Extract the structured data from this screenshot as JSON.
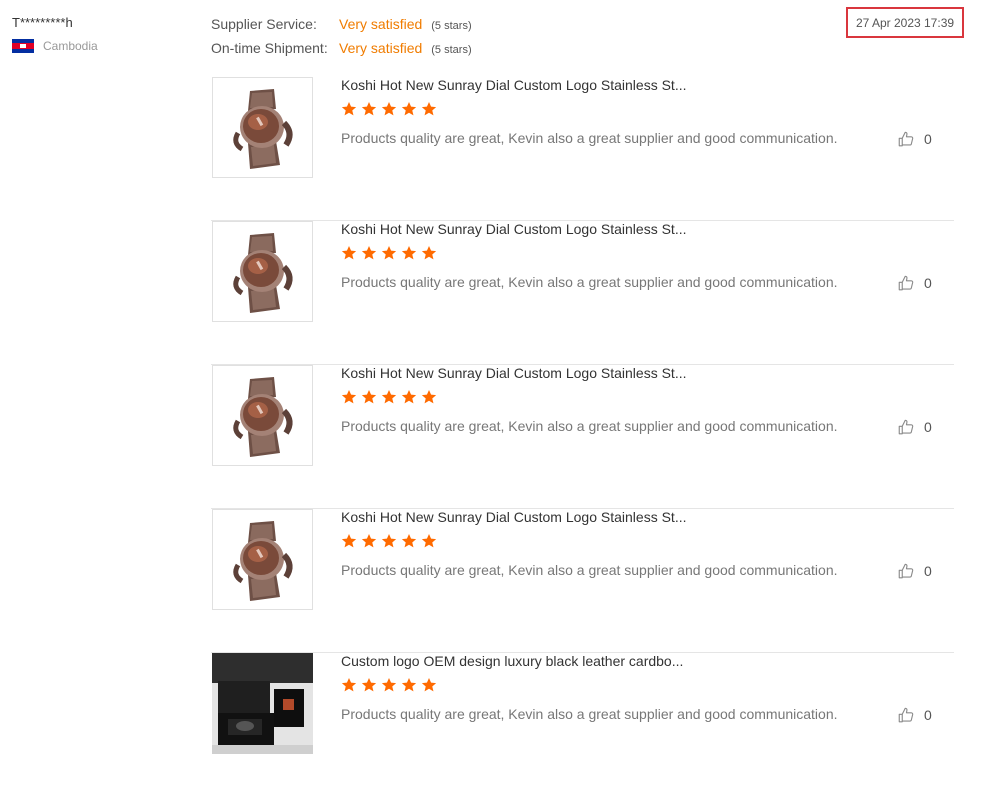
{
  "reviewer": {
    "name": "T*********h",
    "country": "Cambodia"
  },
  "ratings": [
    {
      "label": "Supplier Service:",
      "value": "Very satisfied",
      "stars": "(5 stars)"
    },
    {
      "label": "On-time Shipment:",
      "value": "Very satisfied",
      "stars": "(5 stars)"
    }
  ],
  "date": "27 Apr 2023 17:39",
  "colors": {
    "accent": "#f07c00",
    "star": "#ff6a00",
    "highlight_border": "#d9363e"
  },
  "products": [
    {
      "title": "Koshi Hot New Sunray Dial Custom Logo Stainless St...",
      "rating": 5,
      "comment": "Products quality are great, Kevin also a great supplier and good communication.",
      "likes": "0",
      "image": "bronze-watch"
    },
    {
      "title": "Koshi Hot New Sunray Dial Custom Logo Stainless St...",
      "rating": 5,
      "comment": "Products quality are great, Kevin also a great supplier and good communication.",
      "likes": "0",
      "image": "bronze-watch"
    },
    {
      "title": "Koshi Hot New Sunray Dial Custom Logo Stainless St...",
      "rating": 5,
      "comment": "Products quality are great, Kevin also a great supplier and good communication.",
      "likes": "0",
      "image": "bronze-watch"
    },
    {
      "title": "Koshi Hot New Sunray Dial Custom Logo Stainless St...",
      "rating": 5,
      "comment": "Products quality are great, Kevin also a great supplier and good communication.",
      "likes": "0",
      "image": "bronze-watch"
    },
    {
      "title": "Custom logo OEM design luxury black leather cardbo...",
      "rating": 5,
      "comment": "Products quality are great, Kevin also a great supplier and good communication.",
      "likes": "0",
      "image": "watch-box-photo"
    }
  ]
}
